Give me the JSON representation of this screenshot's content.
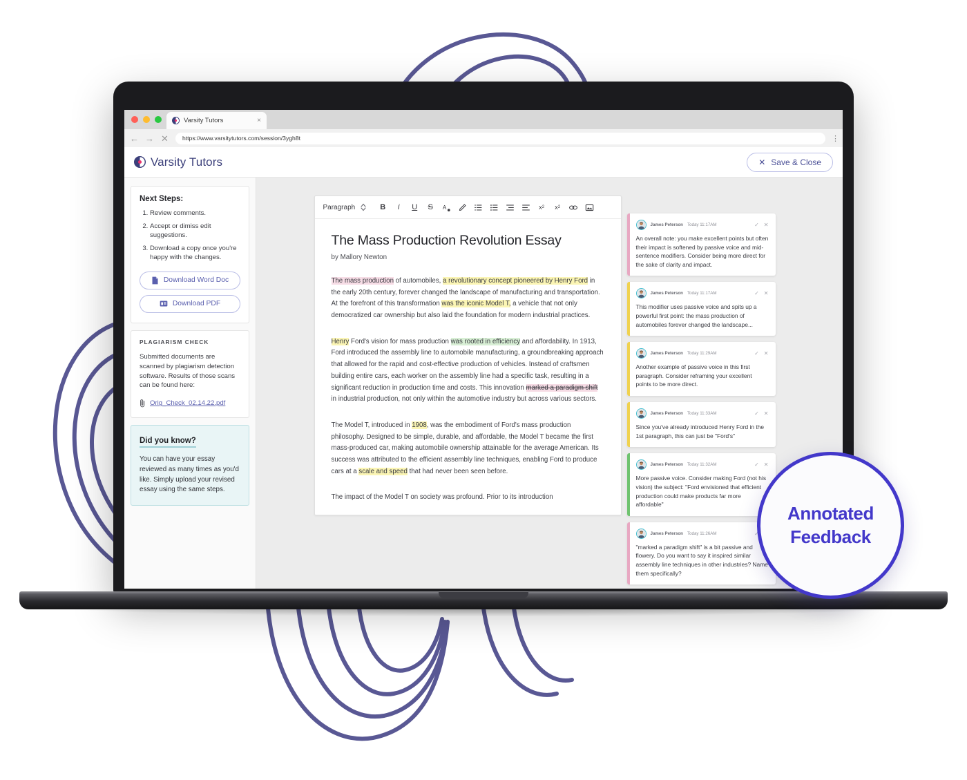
{
  "browser": {
    "tab_title": "Varsity Tutors",
    "tab_close": "×",
    "back_icon": "←",
    "forward_icon": "→",
    "stop_icon": "✕",
    "url": "https://www.varsitytutors.com/session/3ygh8t",
    "menu_icon": "⋮"
  },
  "app": {
    "brand": "Varsity Tutors",
    "save_close_label": "Save & Close",
    "save_close_icon": "✕"
  },
  "sidebar": {
    "next_steps_title": "Next Steps:",
    "steps": [
      "Review comments.",
      "Accept or dimiss edit suggestions.",
      "Download a copy once you're happy with the changes."
    ],
    "download_word_label": "Download Word Doc",
    "download_pdf_label": "Download PDF",
    "plagiarism_label": "PLAGIARISM CHECK",
    "plagiarism_body": "Submitted documents are scanned by plagiarism detection software. Results of those scans can be found here:",
    "plagiarism_file": "Orig_Check_02.14.22.pdf",
    "dyk_title": "Did you know?",
    "dyk_body": "You can have your essay reviewed as many times as you'd like. Simply upload your revised essay using the same steps."
  },
  "toolbar": {
    "paragraph_label": "Paragraph",
    "icons": [
      {
        "name": "bold-icon",
        "glyph": "B"
      },
      {
        "name": "italic-icon",
        "glyph": "i"
      },
      {
        "name": "underline-icon",
        "glyph": "U"
      },
      {
        "name": "strikethrough-icon",
        "glyph": "S"
      },
      {
        "name": "text-color-icon",
        "glyph": "A"
      },
      {
        "name": "highlighter-icon",
        "glyph": "✐"
      },
      {
        "name": "ordered-list-icon",
        "glyph": "≣"
      },
      {
        "name": "unordered-list-icon",
        "glyph": "≣"
      },
      {
        "name": "indent-icon",
        "glyph": "≣"
      },
      {
        "name": "outdent-icon",
        "glyph": "≣"
      },
      {
        "name": "subscript-icon",
        "glyph": "x₂"
      },
      {
        "name": "superscript-icon",
        "glyph": "x²"
      },
      {
        "name": "link-icon",
        "glyph": "∞"
      },
      {
        "name": "image-icon",
        "glyph": "▣"
      }
    ]
  },
  "document": {
    "title": "The Mass Production Revolution Essay",
    "byline": "by Mallory Newton",
    "paragraphs": [
      {
        "runs": [
          {
            "t": "The mass production",
            "h": "pink"
          },
          {
            "t": " of automobiles, ",
            "h": ""
          },
          {
            "t": "a revolutionary concept pioneered by Henry Ford",
            "h": "yellow"
          },
          {
            "t": " in the early 20th century, forever changed the landscape of manufacturing and transportation. At the forefront of this transformation ",
            "h": ""
          },
          {
            "t": "was the iconic Model T,",
            "h": "yellow"
          },
          {
            "t": " a vehicle that not only democratized car ownership but also laid the foundation for modern industrial practices.",
            "h": ""
          }
        ]
      },
      {
        "runs": [
          {
            "t": "Henry",
            "h": "yellow"
          },
          {
            "t": " Ford's vision for mass production ",
            "h": ""
          },
          {
            "t": "was rooted in efficiency",
            "h": "green"
          },
          {
            "t": " and affordability. In 1913, Ford introduced the assembly line to automobile manufacturing, a groundbreaking approach that allowed for the rapid and cost-effective production of vehicles. Instead of craftsmen building entire cars, each worker on the assembly line had a specific task, resulting in a significant reduction in production time and costs. This innovation ",
            "h": ""
          },
          {
            "t": "marked a paradigm shift",
            "h": "strike"
          },
          {
            "t": " in industrial production, not only within the automotive industry but across various sectors.",
            "h": ""
          }
        ]
      },
      {
        "runs": [
          {
            "t": "The Model T, introduced in ",
            "h": ""
          },
          {
            "t": "1908",
            "h": "yellow"
          },
          {
            "t": ", was the embodiment of Ford's mass production philosophy. Designed to be simple, durable, and affordable, the Model T became the first mass-produced car, making automobile ownership attainable for the average American. Its success was attributed to the efficient assembly line techniques, enabling Ford to produce cars at a ",
            "h": ""
          },
          {
            "t": "scale and speed",
            "h": "yellow"
          },
          {
            "t": " that had never been seen before.",
            "h": ""
          }
        ]
      },
      {
        "runs": [
          {
            "t": "The impact of the Model T on society was profound. Prior to its introduction",
            "h": ""
          }
        ]
      }
    ]
  },
  "comments": {
    "accept_icon": "✓",
    "dismiss_icon": "✕",
    "items": [
      {
        "author": "James Peterson",
        "time": "Today 11:17AM",
        "body": "An overall note: you make excellent points but often their impact is softened by passive voice and mid-sentence modifiers. Consider being more direct for the sake of clarity and impact.",
        "color": "#e8a8c2"
      },
      {
        "author": "James Peterson",
        "time": "Today 11:17AM",
        "body": "This modifier uses passive voice and spits up a powerful first point: the mass production of automobiles forever changed the landscape...",
        "color": "#f0d24e"
      },
      {
        "author": "James Peterson",
        "time": "Today 11:29AM",
        "body": "Another example of passive voice in this first paragraph. Consider reframing your excellent points to be more direct.",
        "color": "#f0d24e"
      },
      {
        "author": "James Peterson",
        "time": "Today 11:33AM",
        "body": "Since you've already introduced Henry Ford in the 1st paragraph, this can just be \"Ford's\"",
        "color": "#f0d24e"
      },
      {
        "author": "James Peterson",
        "time": "Today 11:32AM",
        "body": "More passive voice. Consider making Ford (not his vision) the subject: \"Ford envisioned that efficient production could make products far more affordable\"",
        "color": "#6fc36f"
      },
      {
        "author": "James Peterson",
        "time": "Today 11:26AM",
        "body": "\"marked a paradigm shift\" is a bit passive and flowery. Do you want to say it inspired similar assembly line techniques in other industries? Name them specifically?",
        "color": "#e8a8c2"
      }
    ]
  },
  "badge": {
    "line1": "Annotated",
    "line2": "Feedback"
  },
  "colors": {
    "brand_purple": "#3b3f7a",
    "accent_indigo": "#4338ca",
    "highlight_yellow": "#fbf5b4",
    "highlight_pink": "#f6dce5",
    "highlight_green": "#d8efd5"
  }
}
